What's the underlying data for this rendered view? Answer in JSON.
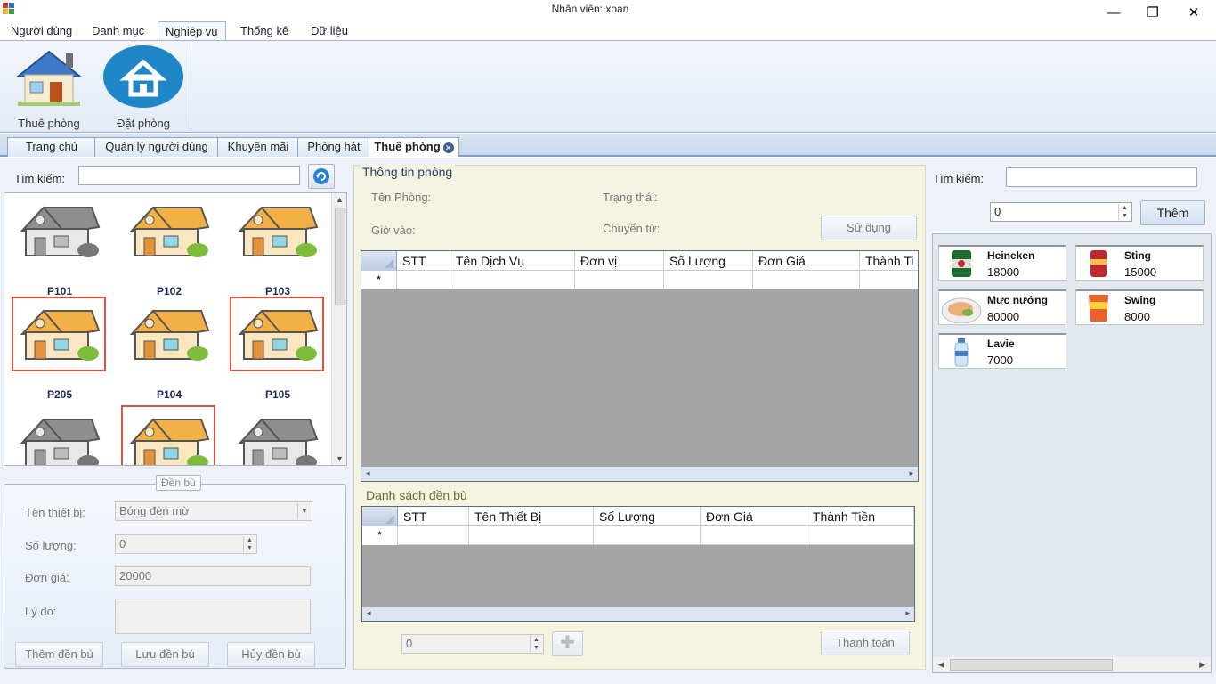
{
  "window": {
    "title": "Nhân viên: xoan"
  },
  "ribbon": {
    "tabs": [
      "Người dùng",
      "Danh mục",
      "Nghiệp vụ",
      "Thống kê",
      "Dữ liệu"
    ],
    "buttons": {
      "thue_phong": "Thuê phòng",
      "dat_phong": "Đặt phòng"
    }
  },
  "doc_tabs": [
    "Trang chủ",
    "Quản lý người dùng",
    "Khuyến mãi",
    "Phòng hát",
    "Thuê phòng"
  ],
  "left": {
    "search_label": "Tìm kiếm:",
    "rooms": [
      {
        "name": "P101",
        "state": "gray"
      },
      {
        "name": "P102",
        "state": "orange"
      },
      {
        "name": "P103",
        "state": "orange"
      },
      {
        "name": "P205",
        "state": "orange-selected"
      },
      {
        "name": "P104",
        "state": "orange"
      },
      {
        "name": "P105",
        "state": "orange-selected"
      },
      {
        "name": "",
        "state": "gray"
      },
      {
        "name": "",
        "state": "orange-selected"
      },
      {
        "name": "",
        "state": "gray"
      }
    ],
    "denbu": {
      "title": "Đền bù",
      "ten_thiet_bi_label": "Tên thiết bị:",
      "ten_thiet_bi_value": "Bóng đèn mờ",
      "so_luong_label": "Số lượng:",
      "so_luong_value": "0",
      "don_gia_label": "Đơn giá:",
      "don_gia_value": "20000",
      "ly_do_label": "Lý do:",
      "btn_them": "Thêm đền bù",
      "btn_luu": "Lưu đền bù",
      "btn_huy": "Hủy đền bù"
    }
  },
  "center": {
    "group_title": "Thông tin phòng",
    "ten_phong_label": "Tên Phòng:",
    "trang_thai_label": "Trạng thái:",
    "gio_vao_label": "Giờ vào:",
    "chuyen_tu_label": "Chuyển từ:",
    "su_dung_btn": "Sử dụng",
    "service_columns": [
      "STT",
      "Tên Dịch Vụ",
      "Đơn vị",
      "Số Lượng",
      "Đơn Giá",
      "Thành Ti"
    ],
    "denbu_title": "Danh sách đền bù",
    "denbu_columns": [
      "STT",
      "Tên Thiết Bị",
      "Số Lượng",
      "Đơn Giá",
      "Thành Tiền"
    ],
    "row_marker": "*",
    "bottom_value": "0",
    "thanh_toan_btn": "Thanh toán"
  },
  "right": {
    "search_label": "Tìm kiếm:",
    "qty_value": "0",
    "them_btn": "Thêm",
    "services": [
      {
        "name": "Heineken",
        "price": "18000",
        "icon": "beer-can-icon"
      },
      {
        "name": "Sting",
        "price": "15000",
        "icon": "red-can-icon"
      },
      {
        "name": "Mực nướng",
        "price": "80000",
        "icon": "squid-dish-icon"
      },
      {
        "name": "Swing",
        "price": "8000",
        "icon": "snack-bag-icon"
      },
      {
        "name": "Lavie",
        "price": "7000",
        "icon": "water-bottle-icon"
      }
    ]
  },
  "colors": {
    "accent": "#1f86c8",
    "selected_outline": "#e0533f",
    "panel": "#eef2f8"
  }
}
